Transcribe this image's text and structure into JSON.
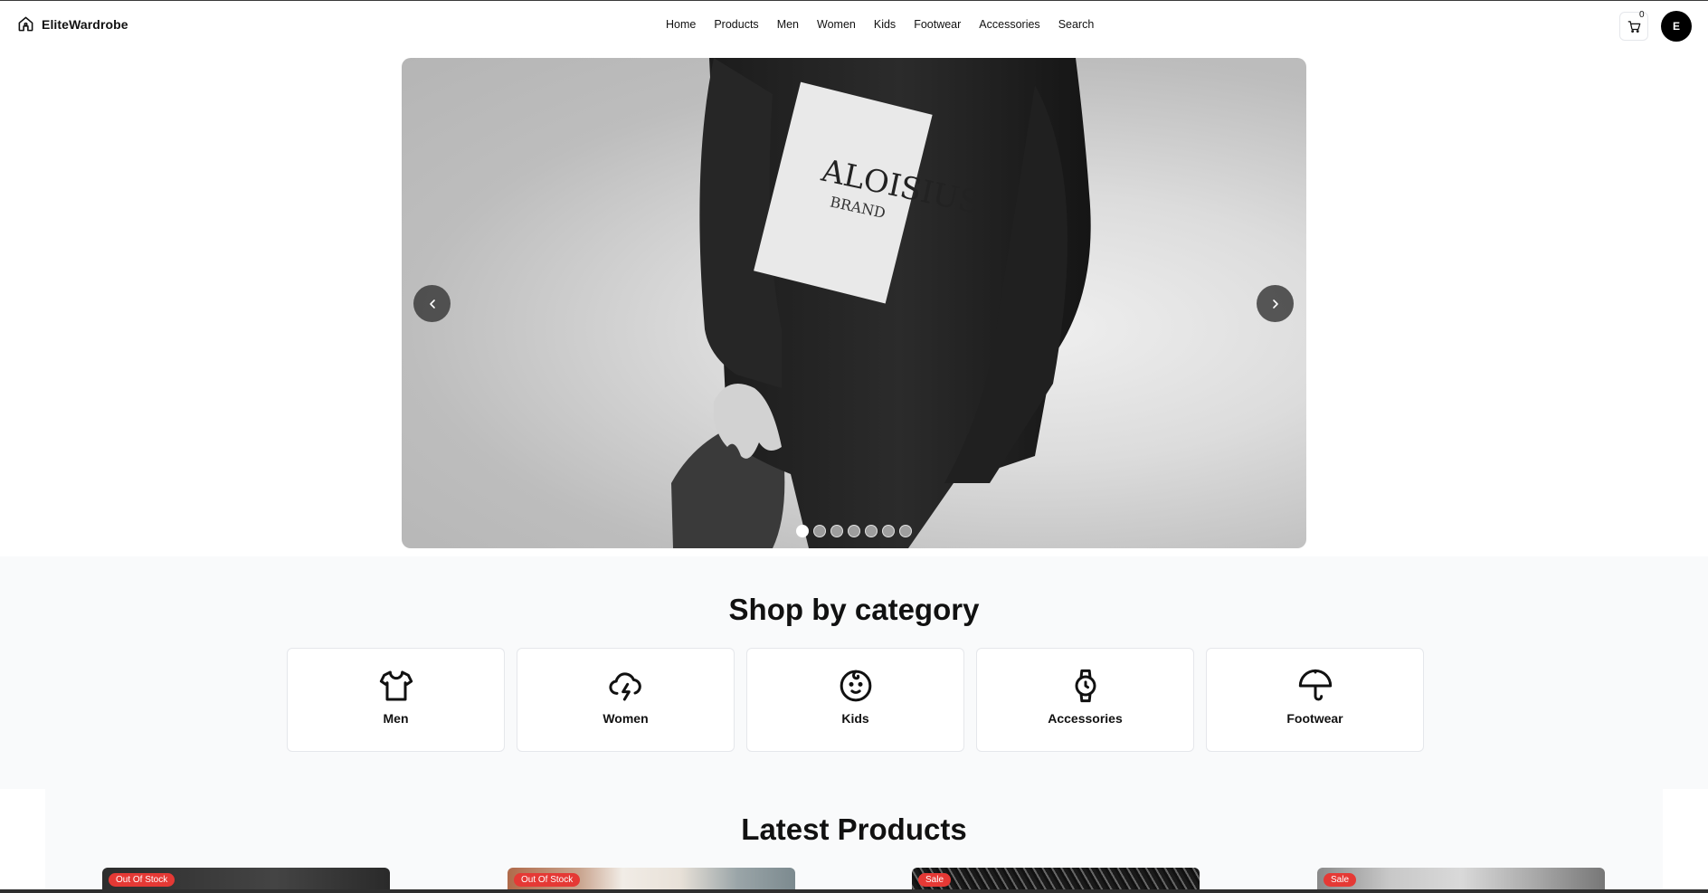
{
  "brand": {
    "name": "EliteWardrobe",
    "icon": "home-icon"
  },
  "nav": [
    {
      "label": "Home"
    },
    {
      "label": "Products"
    },
    {
      "label": "Men"
    },
    {
      "label": "Women"
    },
    {
      "label": "Kids"
    },
    {
      "label": "Footwear"
    },
    {
      "label": "Accessories"
    },
    {
      "label": "Search"
    }
  ],
  "cart": {
    "count": "0",
    "icon": "cart-icon"
  },
  "user": {
    "initial": "E"
  },
  "hero": {
    "slide_text": "ALOISIUS",
    "slide_subtext": "BRAND",
    "slide_count": 7,
    "active_slide": 1,
    "prev_icon": "chevron-left-icon",
    "next_icon": "chevron-right-icon"
  },
  "categories": {
    "title": "Shop by category",
    "items": [
      {
        "label": "Men",
        "icon": "shirt-icon"
      },
      {
        "label": "Women",
        "icon": "cloud-lightning-icon"
      },
      {
        "label": "Kids",
        "icon": "baby-face-icon"
      },
      {
        "label": "Accessories",
        "icon": "watch-icon"
      },
      {
        "label": "Footwear",
        "icon": "umbrella-icon"
      }
    ]
  },
  "latest": {
    "title": "Latest Products",
    "products": [
      {
        "badge": "Out Of Stock"
      },
      {
        "badge": "Out Of Stock"
      },
      {
        "badge": "Sale"
      },
      {
        "badge": "Sale"
      }
    ]
  },
  "colors": {
    "badge": "#e53935",
    "section_bg": "#f9fafb",
    "text": "#111827"
  }
}
